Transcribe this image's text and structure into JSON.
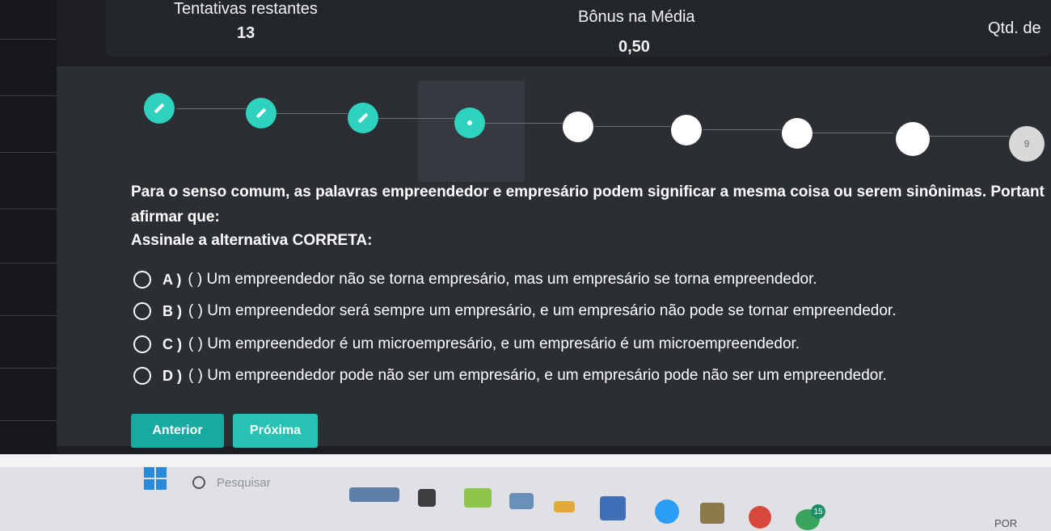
{
  "stats": {
    "attempts_label": "Tentativas restantes",
    "attempts_value": "13",
    "bonus_label": "Bônus na Média",
    "bonus_value": "0,50",
    "qty_label": "Qtd. de"
  },
  "stepper": {
    "steps": [
      {
        "state": "done",
        "icon": "pencil-icon"
      },
      {
        "state": "done",
        "icon": "pencil-icon"
      },
      {
        "state": "done",
        "icon": "pencil-icon"
      },
      {
        "state": "current",
        "icon": "dot-icon"
      },
      {
        "state": "pending"
      },
      {
        "state": "pending"
      },
      {
        "state": "pending"
      },
      {
        "state": "pending"
      },
      {
        "state": "dim",
        "label": "9"
      }
    ],
    "step9_label": "9"
  },
  "question": {
    "text_line1": "Para o senso comum, as palavras empreendedor e empresário podem significar a mesma coisa ou serem sinônimas. Portant",
    "text_line2": "afirmar que:",
    "instruction": "Assinale a alternativa CORRETA:"
  },
  "options": [
    {
      "letter": "A )",
      "text": "( ) Um empreendedor não se torna empresário, mas um empresário se torna empreendedor."
    },
    {
      "letter": "B )",
      "text": "( ) Um empreendedor será sempre um empresário, e um empresário não pode se tornar empreendedor."
    },
    {
      "letter": "C )",
      "text": "( ) Um empreendedor é um microempresário, e um empresário é um microempreendedor."
    },
    {
      "letter": "D )",
      "text": "( ) Um empreendedor pode não ser um empresário, e um empresário pode não ser um empreendedor."
    }
  ],
  "buttons": {
    "previous": "Anterior",
    "next": "Próxima"
  },
  "taskbar": {
    "search_placeholder": "Pesquisar",
    "badge": "15",
    "lang": "POR"
  },
  "colors": {
    "accent": "#2fd3bd",
    "button_prev": "#18a9a0",
    "button_next": "#27c2b4",
    "panel": "#2b2e33"
  }
}
